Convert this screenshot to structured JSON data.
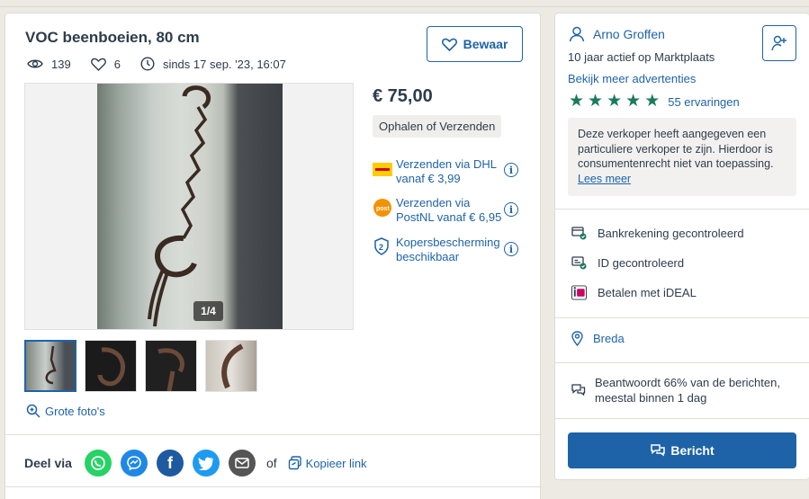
{
  "listing": {
    "title": "VOC beenboeien, 80 cm",
    "views": "139",
    "favorites": "6",
    "since": "sinds 17 sep. '23, 16:07",
    "save_label": "Bewaar",
    "photo_counter": "1/4",
    "price": "€ 75,00",
    "delivery_method": "Ophalen of Verzenden",
    "shipping": [
      {
        "icon": "dhl-logo-icon",
        "line1": "Verzenden via DHL",
        "line2": "vanaf € 3,99"
      },
      {
        "icon": "postnl-logo-icon",
        "line1": "Verzenden via",
        "line2": "PostNL vanaf € 6,95"
      },
      {
        "icon": "buyer-protection-icon",
        "line1": "Kopersbescherming",
        "line2": "beschikbaar"
      }
    ],
    "big_photos_label": "Grote foto's",
    "share_label": "Deel via",
    "or_label": "of",
    "copy_link_label": "Kopieer link"
  },
  "seller": {
    "name": "Arno Groffen",
    "active_text": "10 jaar actief op Marktplaats",
    "more_ads": "Bekijk meer advertenties",
    "rating_stars": 5,
    "reviews": "55 ervaringen",
    "notice_text": "Deze verkoper heeft aangegeven een particuliere verkoper te zijn. Hierdoor is consumentenrecht niet van toepassing.",
    "notice_link": "Lees meer",
    "features": [
      "Bankrekening gecontroleerd",
      "ID gecontroleerd",
      "Betalen met iDEAL"
    ],
    "location": "Breda",
    "reply_line1": "Beantwoordt 66% van de berichten,",
    "reply_line2": "meestal binnen 1 dag",
    "message_button": "Bericht"
  },
  "colors": {
    "brand_blue": "#1e63a8",
    "star_green": "#1a7a5c",
    "whatsapp": "#25d366",
    "messenger": "#1e88e5",
    "facebook": "#1e5aa0",
    "twitter": "#1d9bf0",
    "email": "#555555"
  }
}
